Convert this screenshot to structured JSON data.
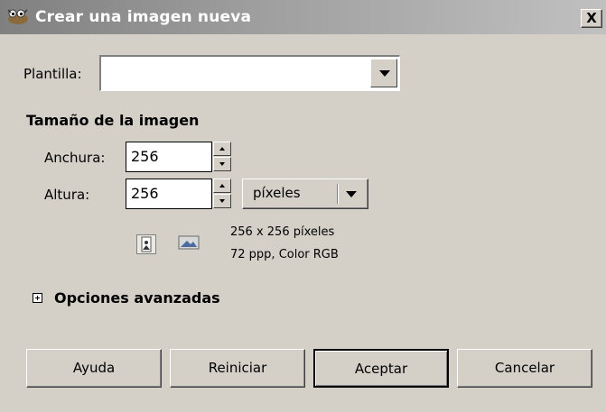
{
  "window": {
    "title": "Crear una imagen nueva",
    "close_label": "X"
  },
  "template": {
    "label": "Plantilla:",
    "value": ""
  },
  "image_size": {
    "section_title": "Tamaño de la imagen",
    "width_label": "Anchura:",
    "width_value": "256",
    "height_label": "Altura:",
    "height_value": "256",
    "unit": "píxeles",
    "info_dimensions": "256 x 256 píxeles",
    "info_resolution": "72 ppp, Color RGB"
  },
  "advanced": {
    "label": "Opciones avanzadas"
  },
  "buttons": {
    "help": "Ayuda",
    "reset": "Reiniciar",
    "ok": "Aceptar",
    "cancel": "Cancelar"
  },
  "icons": {
    "app": "gimp-wilber-icon",
    "portrait": "portrait-orientation-icon",
    "landscape": "landscape-orientation-icon"
  }
}
